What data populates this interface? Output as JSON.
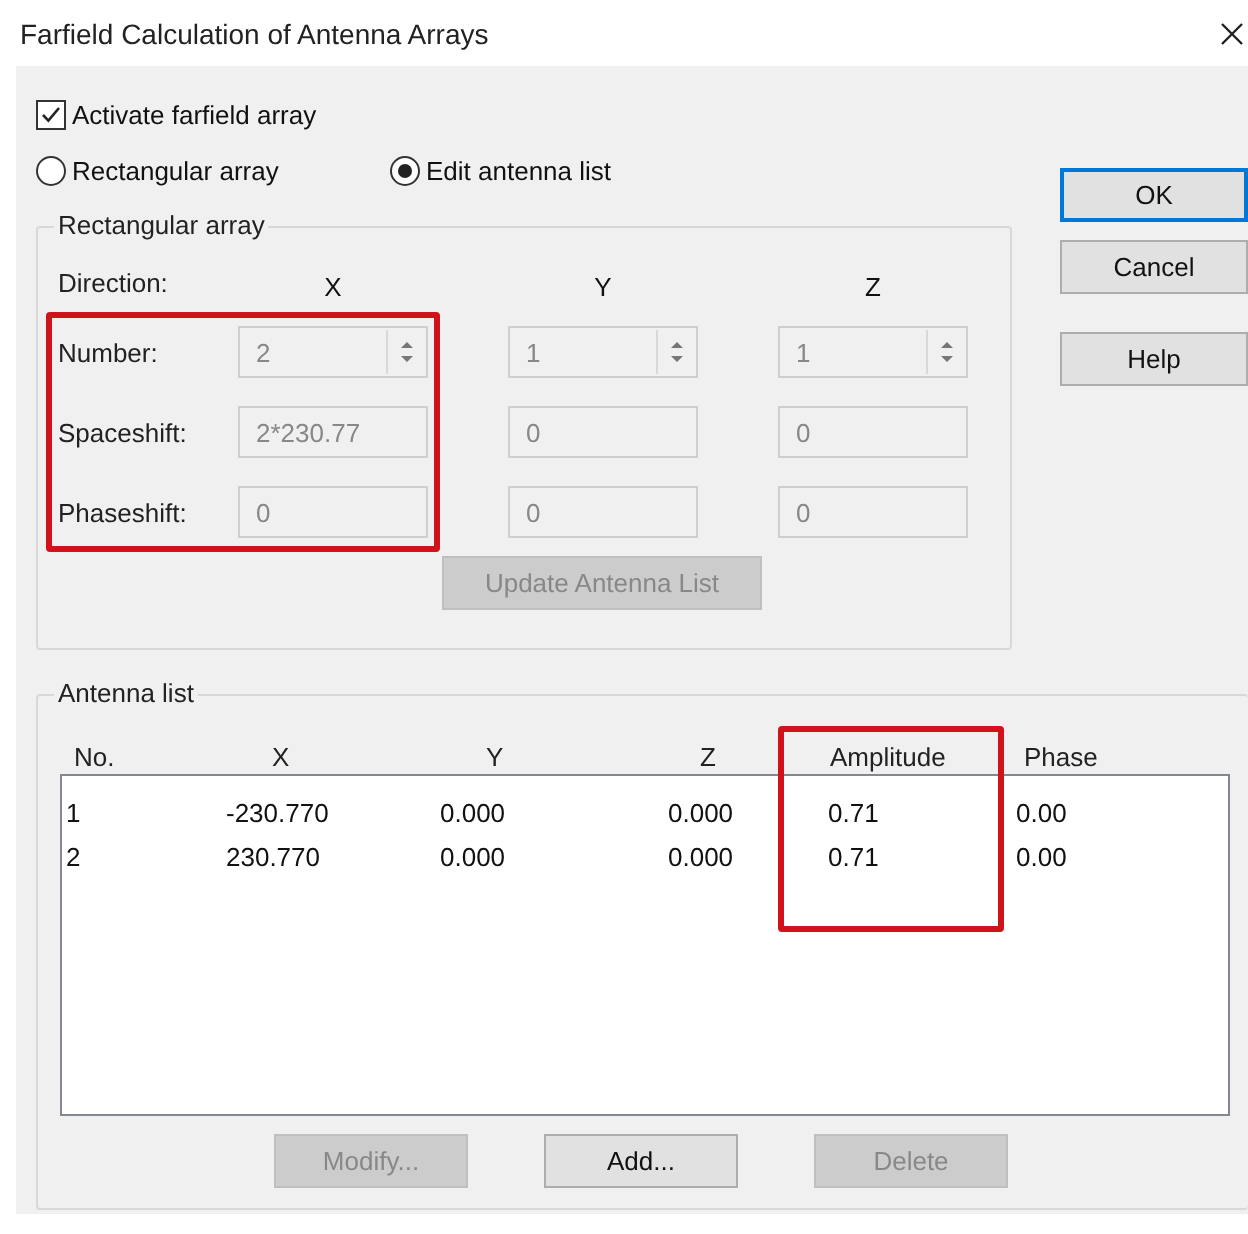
{
  "window": {
    "title": "Farfield Calculation of Antenna Arrays"
  },
  "activate": {
    "label": "Activate farfield array",
    "checked": true
  },
  "mode": [
    {
      "label": "Rectangular array",
      "selected": false
    },
    {
      "label": "Edit antenna list",
      "selected": true
    }
  ],
  "rectangular_array": {
    "title": "Rectangular array",
    "direction_label": "Direction:",
    "disabled": true,
    "columns": [
      {
        "heading": "X",
        "highlighted": true
      },
      {
        "heading": "Y",
        "highlighted": false
      },
      {
        "heading": "Z",
        "highlighted": false
      }
    ],
    "rows": [
      {
        "label": "Number:",
        "kind": "spinner",
        "values": [
          "2",
          "1",
          "1"
        ]
      },
      {
        "label": "Spaceshift:",
        "kind": "text",
        "values": [
          "2*230.77",
          "0",
          "0"
        ]
      },
      {
        "label": "Phaseshift:",
        "kind": "text",
        "values": [
          "0",
          "0",
          "0"
        ]
      }
    ],
    "update_button": {
      "label": "Update Antenna List",
      "disabled": true
    }
  },
  "buttons": [
    {
      "label": "OK",
      "default": true
    },
    {
      "label": "Cancel",
      "default": false
    },
    {
      "label": "Help",
      "default": false
    }
  ],
  "antenna_list": {
    "title": "Antenna list",
    "columns": [
      {
        "heading": "No.",
        "highlighted": false
      },
      {
        "heading": "X",
        "highlighted": false
      },
      {
        "heading": "Y",
        "highlighted": false
      },
      {
        "heading": "Z",
        "highlighted": false
      },
      {
        "heading": "Amplitude",
        "highlighted": true
      },
      {
        "heading": "Phase",
        "highlighted": false
      }
    ],
    "rows": [
      [
        "1",
        "-230.770",
        "0.000",
        "0.000",
        "0.71",
        "0.00"
      ],
      [
        "2",
        "230.770",
        "0.000",
        "0.000",
        "0.71",
        "0.00"
      ]
    ],
    "buttons": [
      {
        "label": "Modify...",
        "disabled": true
      },
      {
        "label": "Add...",
        "disabled": false
      },
      {
        "label": "Delete",
        "disabled": true
      }
    ]
  }
}
